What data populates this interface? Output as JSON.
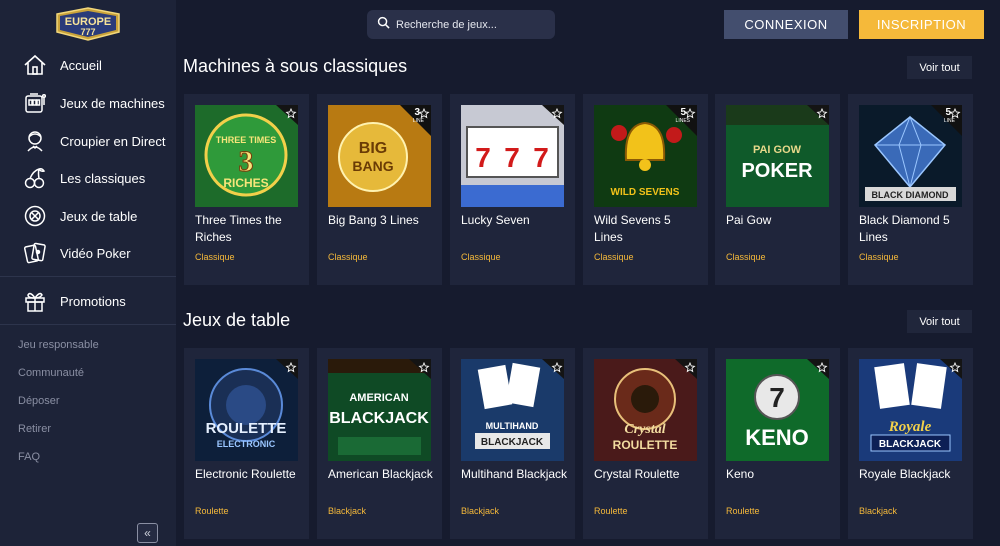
{
  "brand": {
    "logo_text": "EUROPE",
    "logo_sub": "777"
  },
  "header": {
    "search_placeholder": "Recherche de jeux...",
    "login_label": "CONNEXION",
    "signup_label": "INSCRIPTION"
  },
  "sidebar": {
    "items": [
      {
        "label": "Accueil",
        "icon": "home-icon"
      },
      {
        "label": "Jeux de machines",
        "icon": "slot-machine-icon"
      },
      {
        "label": "Croupier en Direct",
        "icon": "dealer-icon"
      },
      {
        "label": "Les classiques",
        "icon": "cherries-icon"
      },
      {
        "label": "Jeux de table",
        "icon": "roulette-chip-icon"
      },
      {
        "label": "Vidéo Poker",
        "icon": "cards-icon"
      }
    ],
    "promotions": {
      "label": "Promotions",
      "icon": "gift-icon"
    },
    "links": [
      "Jeu responsable",
      "Communauté",
      "Déposer",
      "Retirer",
      "FAQ"
    ],
    "collapse_label": "«"
  },
  "sections": [
    {
      "title": "Machines à sous classiques",
      "view_all": "Voir tout",
      "games": [
        {
          "name": "Three Times the Riches",
          "category": "Classique",
          "badge": null,
          "art": "Three Times The Riches"
        },
        {
          "name": "Big Bang 3 Lines",
          "category": "Classique",
          "badge": {
            "num": "3",
            "unit": "LINE"
          },
          "art": "BIG BANG"
        },
        {
          "name": "Lucky Seven",
          "category": "Classique",
          "badge": null,
          "art": "777"
        },
        {
          "name": "Wild Sevens 5 Lines",
          "category": "Classique",
          "badge": {
            "num": "5",
            "unit": "LINES"
          },
          "art": "WILD SEVENS"
        },
        {
          "name": "Pai Gow",
          "category": "Classique",
          "badge": null,
          "art": "PAI GOW POKER"
        },
        {
          "name": "Black Diamond 5 Lines",
          "category": "Classique",
          "badge": {
            "num": "5",
            "unit": "LINE"
          },
          "art": "BLACK DIAMOND"
        }
      ]
    },
    {
      "title": "Jeux de table",
      "view_all": "Voir tout",
      "games": [
        {
          "name": "Electronic Roulette",
          "category": "Roulette",
          "badge": null,
          "art": "ROULETTE ELECTRONIC"
        },
        {
          "name": "American Blackjack",
          "category": "Blackjack",
          "badge": null,
          "art": "AMERICAN BLACKJACK"
        },
        {
          "name": "Multihand Blackjack",
          "category": "Blackjack",
          "badge": null,
          "art": "MULTIHAND BLACKJACK"
        },
        {
          "name": "Crystal Roulette",
          "category": "Roulette",
          "badge": null,
          "art": "Crystal ROULETTE"
        },
        {
          "name": "Keno",
          "category": "Roulette",
          "badge": null,
          "art": "7 KENO"
        },
        {
          "name": "Royale Blackjack",
          "category": "Blackjack",
          "badge": null,
          "art": "Royale BLACKJACK"
        }
      ]
    }
  ],
  "colors": {
    "accent": "#f5b93a",
    "background": "#161b2e",
    "sidebar": "#1d2338",
    "card": "#1f253b"
  }
}
